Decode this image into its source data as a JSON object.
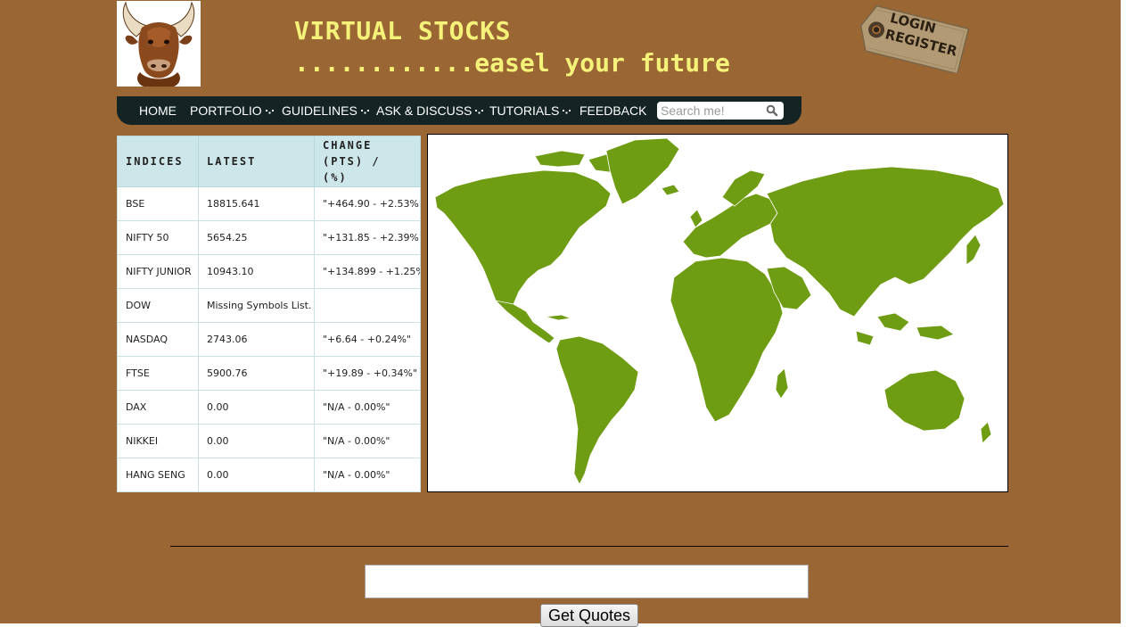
{
  "header": {
    "title": "VIRTUAL STOCKS",
    "tagline": "............easel your future",
    "login_tag": {
      "line1": "LOGIN",
      "line2": "REGISTER"
    },
    "logo_icon": "bull-head-icon"
  },
  "nav": {
    "items": [
      {
        "label": "HOME",
        "dropdown": false
      },
      {
        "label": "PORTFOLIO",
        "dropdown": true
      },
      {
        "label": "GUIDELINES",
        "dropdown": true
      },
      {
        "label": "ASK & DISCUSS",
        "dropdown": true
      },
      {
        "label": "TUTORIALS",
        "dropdown": true
      },
      {
        "label": "FEEDBACK",
        "dropdown": false
      }
    ],
    "search": {
      "placeholder": "Search me!",
      "value": ""
    }
  },
  "indices": {
    "headers": [
      "INDICES",
      "LATEST",
      "CHANGE (PTS) / (%)"
    ],
    "rows": [
      {
        "name": "BSE",
        "latest": "18815.641",
        "change": "\"+464.90 - +2.53%\""
      },
      {
        "name": "NIFTY 50",
        "latest": "5654.25",
        "change": "\"+131.85 - +2.39%\""
      },
      {
        "name": "NIFTY JUNIOR",
        "latest": "10943.10",
        "change": "\"+134.899 - +1.25%\""
      },
      {
        "name": "DOW",
        "latest": "Missing Symbols List.",
        "change": ""
      },
      {
        "name": "NASDAQ",
        "latest": "2743.06",
        "change": "\"+6.64 - +0.24%\""
      },
      {
        "name": "FTSE",
        "latest": "5900.76",
        "change": "\"+19.89 - +0.34%\""
      },
      {
        "name": "DAX",
        "latest": "0.00",
        "change": "\"N/A - 0.00%\""
      },
      {
        "name": "NIKKEI",
        "latest": "0.00",
        "change": "\"N/A - 0.00%\""
      },
      {
        "name": "HANG SENG",
        "latest": "0.00",
        "change": "\"N/A - 0.00%\""
      }
    ]
  },
  "map": {
    "icon": "world-map-icon"
  },
  "quotes": {
    "input_value": "",
    "button_label": "Get Quotes"
  },
  "colors": {
    "background": "#9a6634",
    "title": "#f5f27a",
    "nav": "#142324",
    "table_header": "#cce6e9",
    "map_land": "#6e9c12"
  }
}
